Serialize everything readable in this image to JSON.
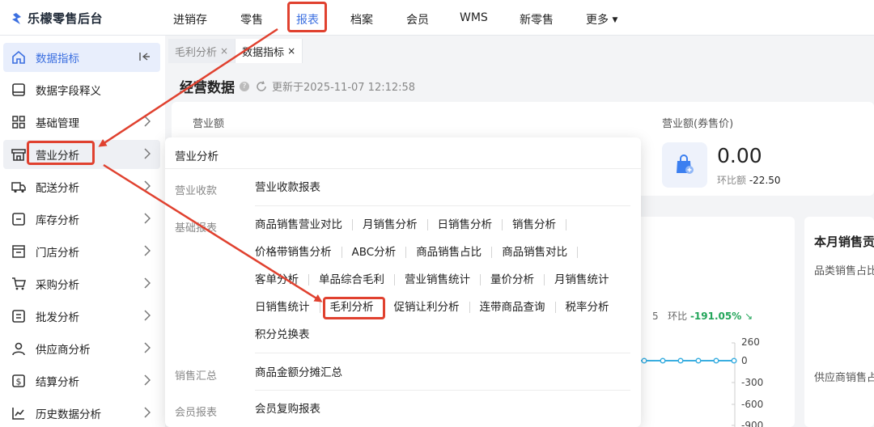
{
  "app": {
    "title": "乐檬零售后台"
  },
  "topnav": {
    "items": [
      {
        "label": "进销存",
        "active": false
      },
      {
        "label": "零售",
        "active": false
      },
      {
        "label": "报表",
        "active": true
      },
      {
        "label": "档案",
        "active": false
      },
      {
        "label": "会员",
        "active": false
      },
      {
        "label": "WMS",
        "active": false
      },
      {
        "label": "新零售",
        "active": false
      },
      {
        "label": "更多",
        "active": false
      }
    ]
  },
  "sidebar": {
    "items": [
      {
        "label": "数据指标",
        "icon": "home-icon",
        "active": true
      },
      {
        "label": "数据字段释义",
        "icon": "monitor-icon"
      },
      {
        "label": "基础管理",
        "icon": "grid-icon"
      },
      {
        "label": "营业分析",
        "icon": "store-icon",
        "hover": true
      },
      {
        "label": "配送分析",
        "icon": "truck-icon"
      },
      {
        "label": "库存分析",
        "icon": "inventory-icon"
      },
      {
        "label": "门店分析",
        "icon": "shop-icon"
      },
      {
        "label": "采购分析",
        "icon": "cart-icon"
      },
      {
        "label": "批发分析",
        "icon": "wholesale-icon"
      },
      {
        "label": "供应商分析",
        "icon": "user-icon"
      },
      {
        "label": "结算分析",
        "icon": "settlement-icon"
      },
      {
        "label": "历史数据分析",
        "icon": "chart-line-icon"
      }
    ]
  },
  "tabs": [
    {
      "label": "毛利分析",
      "close": "×",
      "active": false
    },
    {
      "label": "数据指标",
      "close": "×",
      "active": true
    }
  ],
  "main": {
    "title": "经营数据",
    "help": "?",
    "updated": "更新于2025-11-07 12:12:58",
    "revenue_label": "营业额",
    "revenue_voucher_label": "营业额(券售价)",
    "stat_value": "0.00",
    "stat_sub_label": "环比额",
    "stat_sub_value": "-22.50",
    "ratio_prefix": "5",
    "ratio_label": "环比",
    "ratio_value": "-191.05%",
    "axis_ticks": [
      "260",
      "0",
      "-300",
      "-600",
      "-900"
    ],
    "right_card": {
      "title": "本月销售贡",
      "line1": "品类销售占比",
      "line2": "供应商销售占"
    }
  },
  "popup": {
    "title": "营业分析",
    "sections": [
      {
        "label": "营业收款",
        "rows": [
          [
            "营业收款报表"
          ]
        ]
      },
      {
        "label": "基础报表",
        "rows": [
          [
            "商品销售营业对比",
            "月销售分析",
            "日销售分析",
            "销售分析"
          ],
          [
            "价格带销售分析",
            "ABC分析",
            "商品销售占比",
            "商品销售对比"
          ],
          [
            "客单分析",
            "单品综合毛利",
            "营业销售统计",
            "量价分析",
            "月销售统计"
          ],
          [
            "日销售统计",
            "毛利分析",
            "促销让利分析",
            "连带商品查询",
            "税率分析"
          ],
          [
            "积分兑换表"
          ]
        ]
      },
      {
        "label": "销售汇总",
        "rows": [
          [
            "商品金额分摊汇总"
          ]
        ]
      },
      {
        "label": "会员报表",
        "rows": [
          [
            "会员复购报表"
          ]
        ]
      }
    ]
  },
  "colors": {
    "accent": "#3b6fe0",
    "annotation_red": "#e0412f",
    "positive_green": "#23a55a",
    "chart_line": "#3aaee0"
  }
}
